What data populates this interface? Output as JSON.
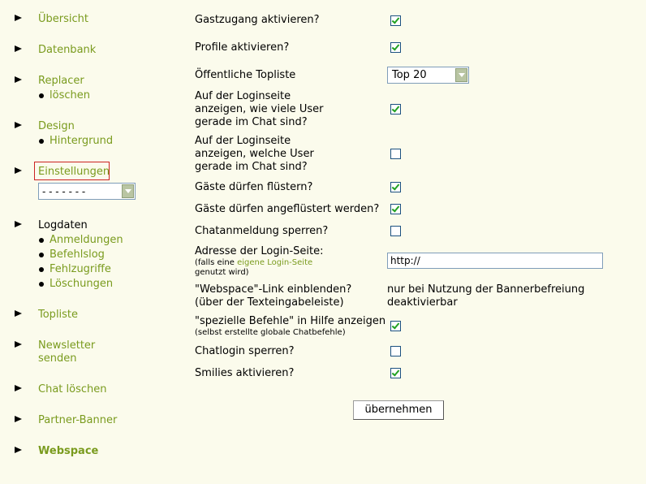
{
  "nav": {
    "items": [
      {
        "label": "Übersicht"
      },
      {
        "label": "Datenbank"
      },
      {
        "label": "Replacer",
        "subs": [
          "löschen"
        ]
      },
      {
        "label": "Design",
        "subs": [
          "Hintergrund"
        ]
      },
      {
        "label": "Einstellungen",
        "select_value": "- - - - - - -"
      },
      {
        "label": "Logdaten",
        "subs": [
          "Anmeldungen",
          "Befehlslog",
          "Fehlzugriffe",
          "Löschungen"
        ]
      },
      {
        "label": "Topliste"
      },
      {
        "label": "Newsletter",
        "label2": "senden"
      },
      {
        "label": "Chat löschen"
      },
      {
        "label": "Partner-Banner"
      },
      {
        "label": "Webspace"
      }
    ]
  },
  "settings": {
    "guest_access": {
      "label": "Gastzugang aktivieren?",
      "checked": true
    },
    "profiles": {
      "label": "Profile aktivieren?",
      "checked": true
    },
    "toplist": {
      "label": "Öffentliche Topliste",
      "value": "Top 20"
    },
    "login_count": {
      "lines": [
        "Auf der Loginseite",
        "anzeigen, wie viele User",
        "gerade im Chat sind?"
      ],
      "checked": true
    },
    "login_users": {
      "lines": [
        "Auf der Loginseite",
        "anzeigen, welche User",
        "gerade im Chat sind?"
      ],
      "checked": false
    },
    "guests_whisper": {
      "label": "Gäste dürfen flüstern?",
      "checked": true
    },
    "guests_whispered": {
      "label": "Gäste dürfen angeflüstert werden?",
      "checked": true
    },
    "chat_registration": {
      "label": "Chatanmeldung sperren?",
      "checked": false
    },
    "login_address": {
      "label": "Adresse der Login-Seite:",
      "note_pre": "(falls eine ",
      "note_link": "eigene Login-Seite",
      "note_post": "genutzt wird)",
      "value": "http://"
    },
    "webspace_link": {
      "label": "\"Webspace\"-Link einblenden?",
      "label2": "(über der Texteingabeleiste)",
      "note": "nur bei Nutzung der Bannerbefreiung",
      "note2": "deaktivierbar"
    },
    "special_commands": {
      "label": "\"spezielle Befehle\" in Hilfe anzeigen",
      "sub": "(selbst erstellte globale Chatbefehle)",
      "checked": true
    },
    "chatlogin_lock": {
      "label": "Chatlogin sperren?",
      "checked": false
    },
    "smilies": {
      "label": "Smilies aktivieren?",
      "checked": true
    },
    "submit_label": "übernehmen"
  }
}
